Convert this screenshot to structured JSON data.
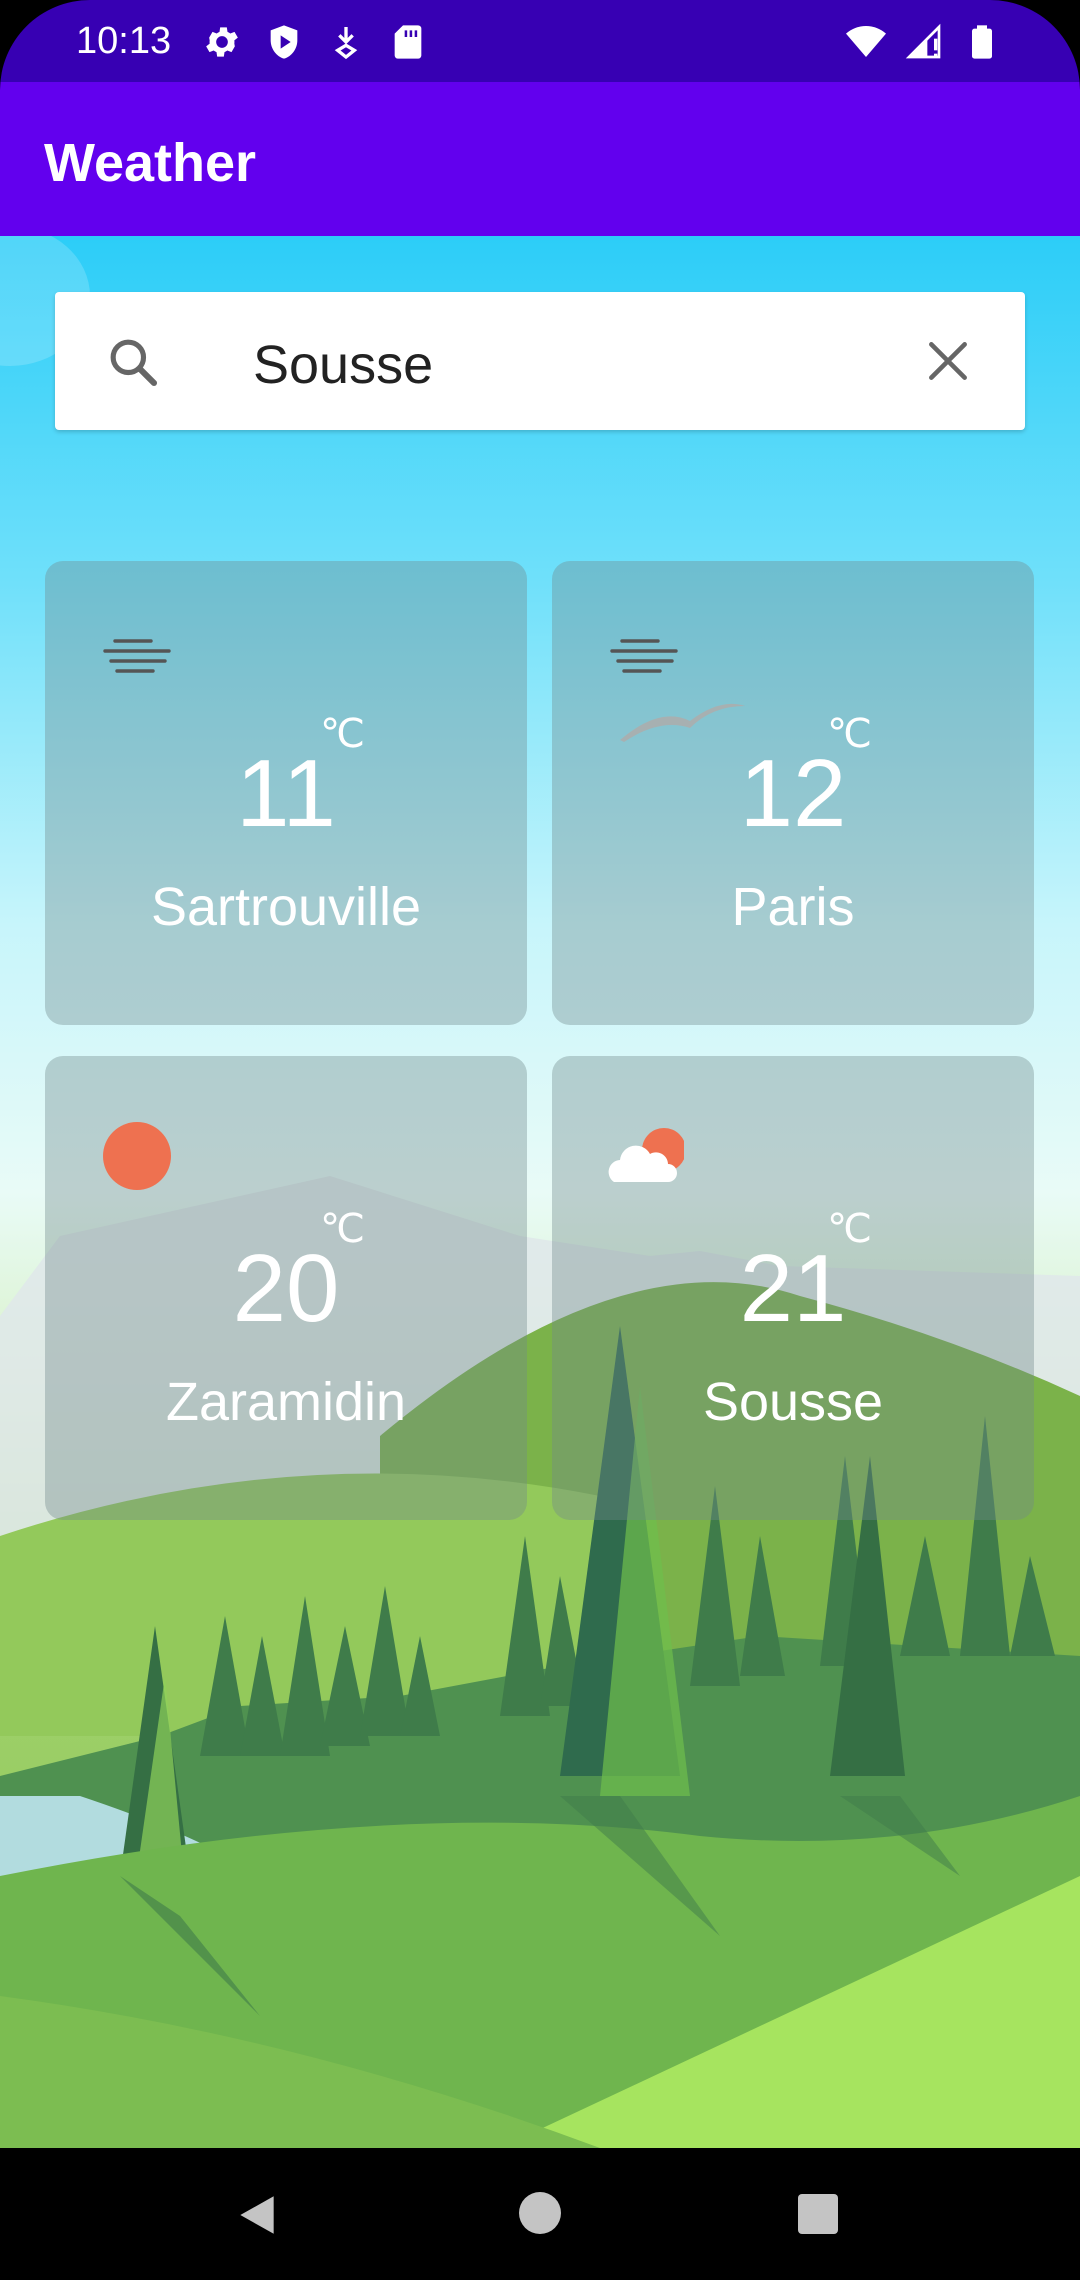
{
  "status_bar": {
    "time": "10:13",
    "left_icons": [
      "settings-icon",
      "shield-icon",
      "download-icon",
      "sd-card-icon"
    ],
    "right_icons": [
      "wifi-icon",
      "cellular-icon",
      "battery-icon"
    ]
  },
  "app_bar": {
    "title": "Weather"
  },
  "search": {
    "value": "Sousse"
  },
  "cards": [
    {
      "city": "Sartrouville",
      "temp": "11",
      "unit": "℃",
      "icon": "fog-icon"
    },
    {
      "city": "Paris",
      "temp": "12",
      "unit": "℃",
      "icon": "fog-icon"
    },
    {
      "city": "Zaramidin",
      "temp": "20",
      "unit": "℃",
      "icon": "sun-icon"
    },
    {
      "city": "Sousse",
      "temp": "21",
      "unit": "℃",
      "icon": "partly-cloudy-icon"
    }
  ],
  "nav_bar": {
    "icons": [
      "back-icon",
      "home-icon",
      "recents-icon"
    ]
  },
  "colors": {
    "status_bar": "#3700b3",
    "app_bar": "#6200ee",
    "sun": "#ee7150"
  }
}
